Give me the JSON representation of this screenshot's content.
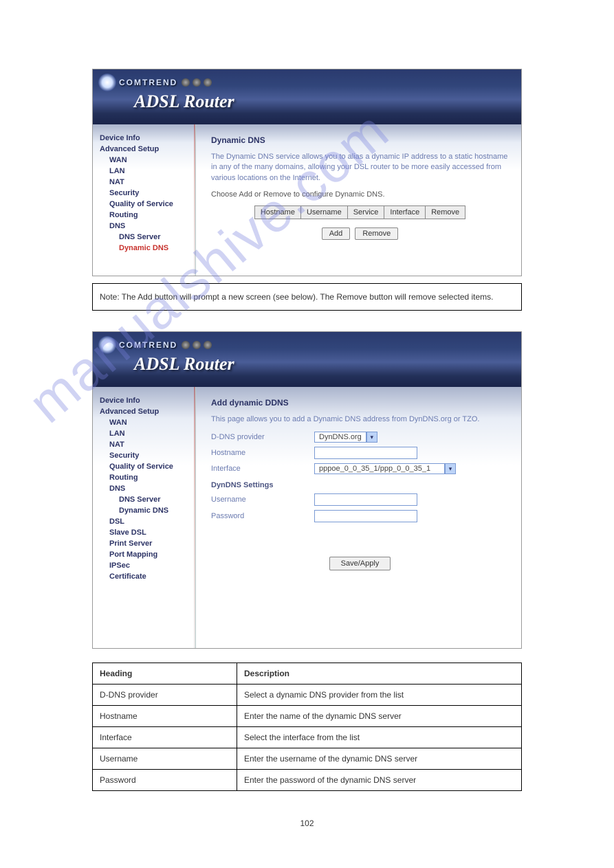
{
  "watermark": "manualshive.com",
  "page_number": "102",
  "header": {
    "brand": "COMTREND",
    "title": "ADSL Router"
  },
  "panel1": {
    "nav": {
      "device_info": "Device Info",
      "adv_setup": "Advanced Setup",
      "wan": "WAN",
      "lan": "LAN",
      "nat": "NAT",
      "security": "Security",
      "qos": "Quality of Service",
      "routing": "Routing",
      "dns": "DNS",
      "dns_server": "DNS Server",
      "dyn_dns": "Dynamic DNS"
    },
    "content": {
      "heading": "Dynamic DNS",
      "desc": "The Dynamic DNS service allows you to alias a dynamic IP address to a static hostname in any of the many domains, allowing your DSL router to be more easily accessed from various locations on the Internet.",
      "instr": "Choose Add or Remove to configure Dynamic DNS.",
      "cols": {
        "hostname": "Hostname",
        "username": "Username",
        "service": "Service",
        "interface": "Interface",
        "remove": "Remove"
      },
      "btn_add": "Add",
      "btn_remove": "Remove"
    }
  },
  "note1": "Note: The Add button will prompt a new screen (see below). The Remove button will remove selected items.",
  "panel2": {
    "nav": {
      "device_info": "Device Info",
      "adv_setup": "Advanced Setup",
      "wan": "WAN",
      "lan": "LAN",
      "nat": "NAT",
      "security": "Security",
      "qos": "Quality of Service",
      "routing": "Routing",
      "dns": "DNS",
      "dns_server": "DNS Server",
      "dyn_dns": "Dynamic DNS",
      "dsl": "DSL",
      "slave_dsl": "Slave DSL",
      "print_server": "Print Server",
      "port_mapping": "Port Mapping",
      "ipsec": "IPSec",
      "cert": "Certificate"
    },
    "content": {
      "heading": "Add dynamic DDNS",
      "desc": "This page allows you to add a Dynamic DNS address from DynDNS.org or TZO.",
      "provider_label": "D-DNS provider",
      "provider_value": "DynDNS.org",
      "hostname_label": "Hostname",
      "interface_label": "Interface",
      "interface_value": "pppoe_0_0_35_1/ppp_0_0_35_1",
      "settings_heading": "DynDNS Settings",
      "username_label": "Username",
      "password_label": "Password",
      "btn_save": "Save/Apply"
    }
  },
  "info_table": {
    "head_label": "Heading",
    "head_desc": "Description",
    "rows": [
      {
        "k": "D-DNS provider",
        "v": "Select a dynamic DNS provider from the list"
      },
      {
        "k": "Hostname",
        "v": "Enter the name of the dynamic DNS server"
      },
      {
        "k": "Interface",
        "v": "Select the interface from the list"
      },
      {
        "k": "Username",
        "v": "Enter the username of the dynamic DNS server"
      },
      {
        "k": "Password",
        "v": "Enter the password of the dynamic DNS server"
      }
    ]
  }
}
